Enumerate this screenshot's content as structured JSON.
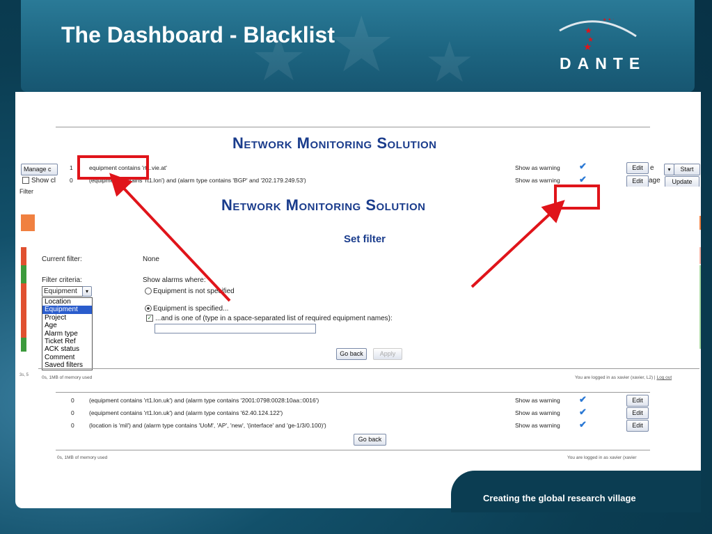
{
  "slide": {
    "title": "The Dashboard - Blacklist",
    "logo_text": "DANTE",
    "tagline": "Creating the global research village"
  },
  "colors": {
    "accent_red": "#e0141a",
    "title_blue": "#1a3c8c",
    "slide_bg": "#0b3d52"
  },
  "app_title": "Network Monitoring Solution",
  "back_screen": {
    "rows_top": [
      {
        "count": "1",
        "condition": "equipment contains 'rt1.vie.at'",
        "action": "Show as warning",
        "edit": "Edit"
      },
      {
        "count": "0",
        "condition": "(equipment contains 'rt1.lon') and (alarm type contains 'BGP' and '202.179.249.53')",
        "action": "Show as warning",
        "edit": "Edit"
      }
    ],
    "rows_bottom": [
      {
        "count": "0",
        "condition": "(equipment contains 'rt1.lon.uk') and (alarm type contains '2001:0798:0028:10aa::0016')",
        "action": "Show as warning",
        "edit": "Edit"
      },
      {
        "count": "0",
        "condition": "(equipment contains 'rt1.lon.uk') and (alarm type contains '62.40.124.122')",
        "action": "Show as warning",
        "edit": "Edit"
      },
      {
        "count": "0",
        "condition": "(location is 'mil') and (alarm type contains 'UoM', 'AP', 'new', '(interface' and 'ge-1/3/0.100)')",
        "action": "Show as warning",
        "edit": "Edit"
      }
    ],
    "go_back": "Go back",
    "footer_left": "0s, 1MB of memory used",
    "footer_right": "You are logged in as xavier (xavier"
  },
  "side_controls": {
    "manage": "Manage c",
    "show": "Show cl",
    "filter": "Filter",
    "side_footer": "3s, 5",
    "select_suffix": "e",
    "start": "Start",
    "page_suffix": "age",
    "update": "Update"
  },
  "set_filter": {
    "heading": "Set filter",
    "current_filter_label": "Current filter:",
    "current_filter_value": "None",
    "criteria_label": "Filter criteria:",
    "criteria_selected": "Equipment",
    "criteria_options": [
      "Location",
      "Equipment",
      "Project",
      "Age",
      "Alarm type",
      "Ticket Ref",
      "ACK status",
      "Comment",
      "Saved filters"
    ],
    "show_where_label": "Show alarms where:",
    "radio_not_specified": "Equipment is not specified",
    "radio_specified": "Equipment is specified...",
    "checkbox_label": "...and is one of (type in a space-separated list of required equipment names):",
    "equipment_input_value": "",
    "go_back": "Go back",
    "apply": "Apply",
    "footer_left": "0s, 1MB of memory used",
    "footer_right": "You are logged in as xavier (xavier, L2) |",
    "logout": "Log out"
  }
}
